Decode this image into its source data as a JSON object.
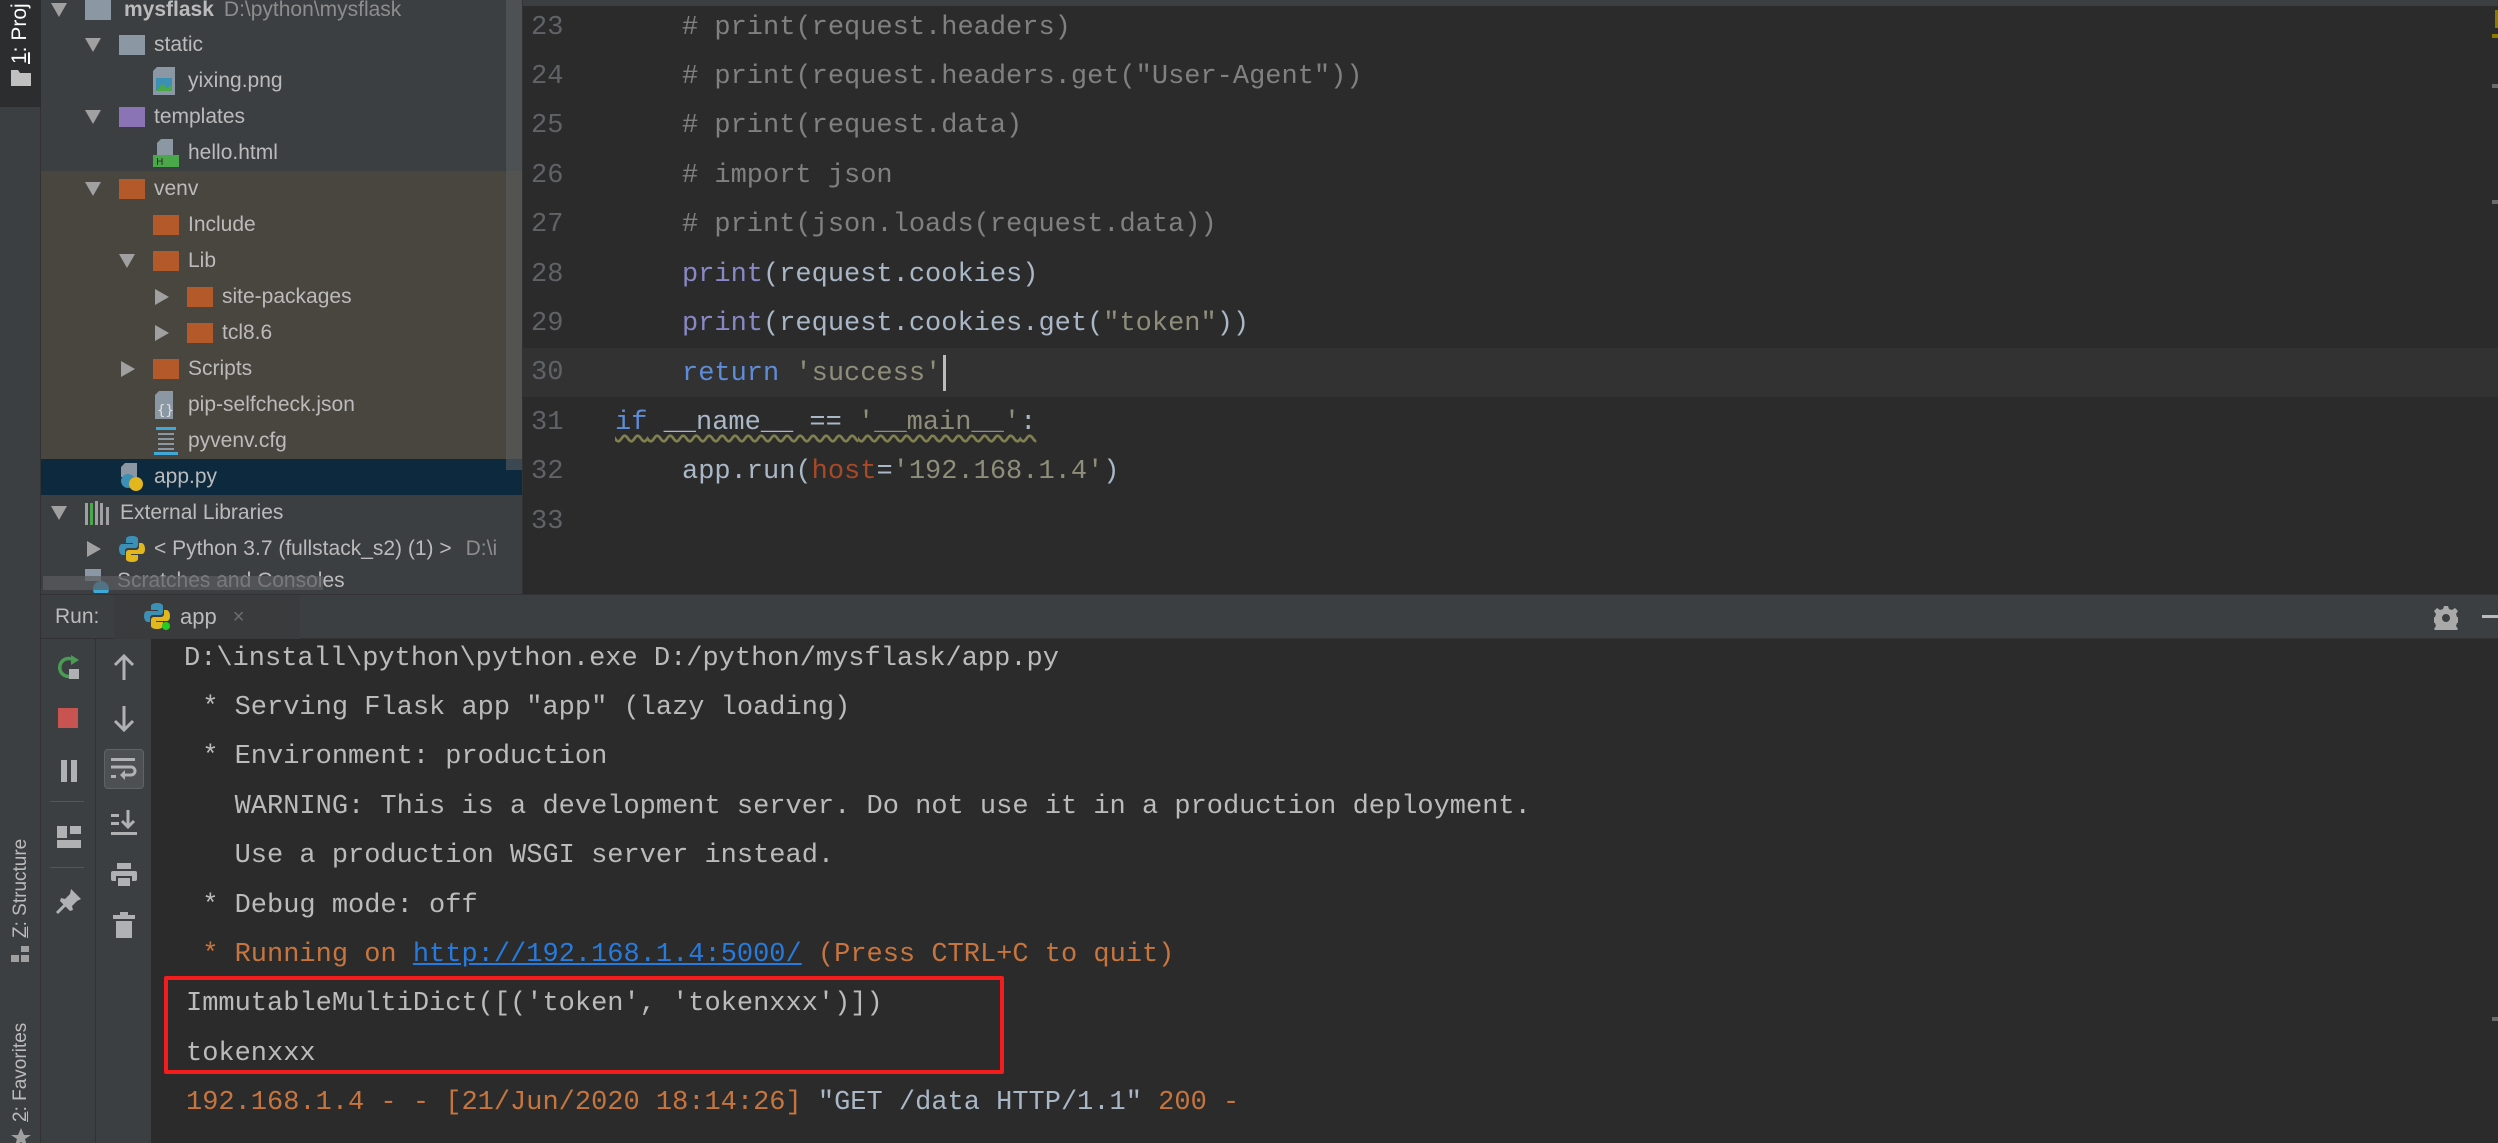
{
  "tool_strip": {
    "project_tab": {
      "prefix": "1",
      "label": ": Proj"
    },
    "structure_tab": {
      "prefix": "Z",
      "label": ": Structure"
    },
    "favorites_tab": {
      "prefix": "2",
      "label": ": Favorites"
    }
  },
  "project_tree": {
    "items": [
      {
        "name": "mysflask",
        "path": "D:\\python\\mysflask",
        "type": "root-folder",
        "expanded": true
      },
      {
        "name": "static",
        "type": "folder",
        "expanded": true
      },
      {
        "name": "yixing.png",
        "type": "image-file"
      },
      {
        "name": "templates",
        "type": "templates-folder",
        "expanded": true
      },
      {
        "name": "hello.html",
        "type": "html-file"
      },
      {
        "name": "venv",
        "type": "excluded-folder",
        "expanded": true
      },
      {
        "name": "Include",
        "type": "excluded-folder"
      },
      {
        "name": "Lib",
        "type": "excluded-folder",
        "expanded": true
      },
      {
        "name": "site-packages",
        "type": "excluded-folder",
        "expanded": false
      },
      {
        "name": "tcl8.6",
        "type": "excluded-folder",
        "expanded": false
      },
      {
        "name": "Scripts",
        "type": "excluded-folder",
        "expanded": false
      },
      {
        "name": "pip-selfcheck.json",
        "type": "json-file"
      },
      {
        "name": "pyvenv.cfg",
        "type": "config-file"
      },
      {
        "name": "app.py",
        "type": "python-file",
        "selected": true
      },
      {
        "name": "External Libraries",
        "type": "libraries",
        "expanded": true
      },
      {
        "name": "< Python 3.7 (fullstack_s2) (1) >",
        "path": "D:\\i",
        "type": "python-sdk",
        "expanded": false
      },
      {
        "name": "Scratches and Consoles",
        "type": "scratches"
      }
    ]
  },
  "editor": {
    "lines": [
      {
        "num": "23",
        "text": "    # print(request.headers)"
      },
      {
        "num": "24",
        "text": "    # print(request.headers.get(\"User-Agent\"))"
      },
      {
        "num": "25",
        "text": "    # print(request.data)"
      },
      {
        "num": "26",
        "text": "    # import json"
      },
      {
        "num": "27",
        "text": "    # print(json.loads(request.data))"
      },
      {
        "num": "28",
        "text": "    print(request.cookies)"
      },
      {
        "num": "29",
        "text": "    print(request.cookies.get(\"token\"))"
      },
      {
        "num": "30",
        "text": "    return 'success'"
      },
      {
        "num": "31",
        "text": "if __name__ == '__main__':"
      },
      {
        "num": "32",
        "text": "    app.run(host='192.168.1.4')"
      },
      {
        "num": "33",
        "text": ""
      }
    ],
    "current_line": "30",
    "tokens": {
      "l23": "# print(request.headers)",
      "l24": "# print(request.headers.get(\"User-Agent\"))",
      "l25": "# print(request.data)",
      "l26": "# import json",
      "l27": "# print(json.loads(request.data))",
      "l28_fn": "print",
      "l28_rest": "(request.cookies)",
      "l29_fn": "print",
      "l29_a": "(request.cookies.get(",
      "l29_str": "\"token\"",
      "l29_b": "))",
      "l30_kw": "return",
      "l30_str": " 'success'",
      "l31_kw": "if",
      "l31_a": " __name__ == ",
      "l31_str": "'__main__'",
      "l31_b": ":",
      "l32_a": "app.run(",
      "l32_param": "host",
      "l32_eq": "=",
      "l32_str": "'192.168.1.4'",
      "l32_b": ")"
    }
  },
  "run_panel": {
    "label": "Run:",
    "tab": {
      "name": "app",
      "close": "×"
    },
    "toolbar": [
      "rerun",
      "stop",
      "pause",
      "layout",
      "pin",
      "scroll-up",
      "scroll-down",
      "soft-wrap",
      "scroll-to-end",
      "print",
      "clear"
    ],
    "console": {
      "line1": "D:\\install\\python\\python.exe D:/python/mysflask/app.py",
      "line2": " * Serving Flask app \"app\" (lazy loading)",
      "line3": " * Environment: production",
      "line4": "   WARNING: This is a development server. Do not use it in a production deployment.",
      "line5": "   Use a production WSGI server instead.",
      "line6": " * Debug mode: off",
      "line7_a": " * Running on ",
      "line7_link": "http://192.168.1.4:5000/",
      "line7_b": " (Press CTRL+C to quit)",
      "line8": "ImmutableMultiDict([('token', 'tokenxxx')])",
      "line9": "tokenxxx",
      "line10_a": "192.168.1.4 - - [21/Jun/2020 18:14:26] ",
      "line10_req": "\"GET /data HTTP/1.1\"",
      "line10_b": " 200 -"
    }
  },
  "colors": {
    "highlight_box": "#f41c1c",
    "keyword": "#5f8cd6",
    "builtin": "#8888c6",
    "comment": "#808080",
    "string": "#8e8e7a",
    "param": "#aa4926",
    "console_orange": "#c7753f",
    "link": "#287bde",
    "selection": "#0d293e"
  }
}
